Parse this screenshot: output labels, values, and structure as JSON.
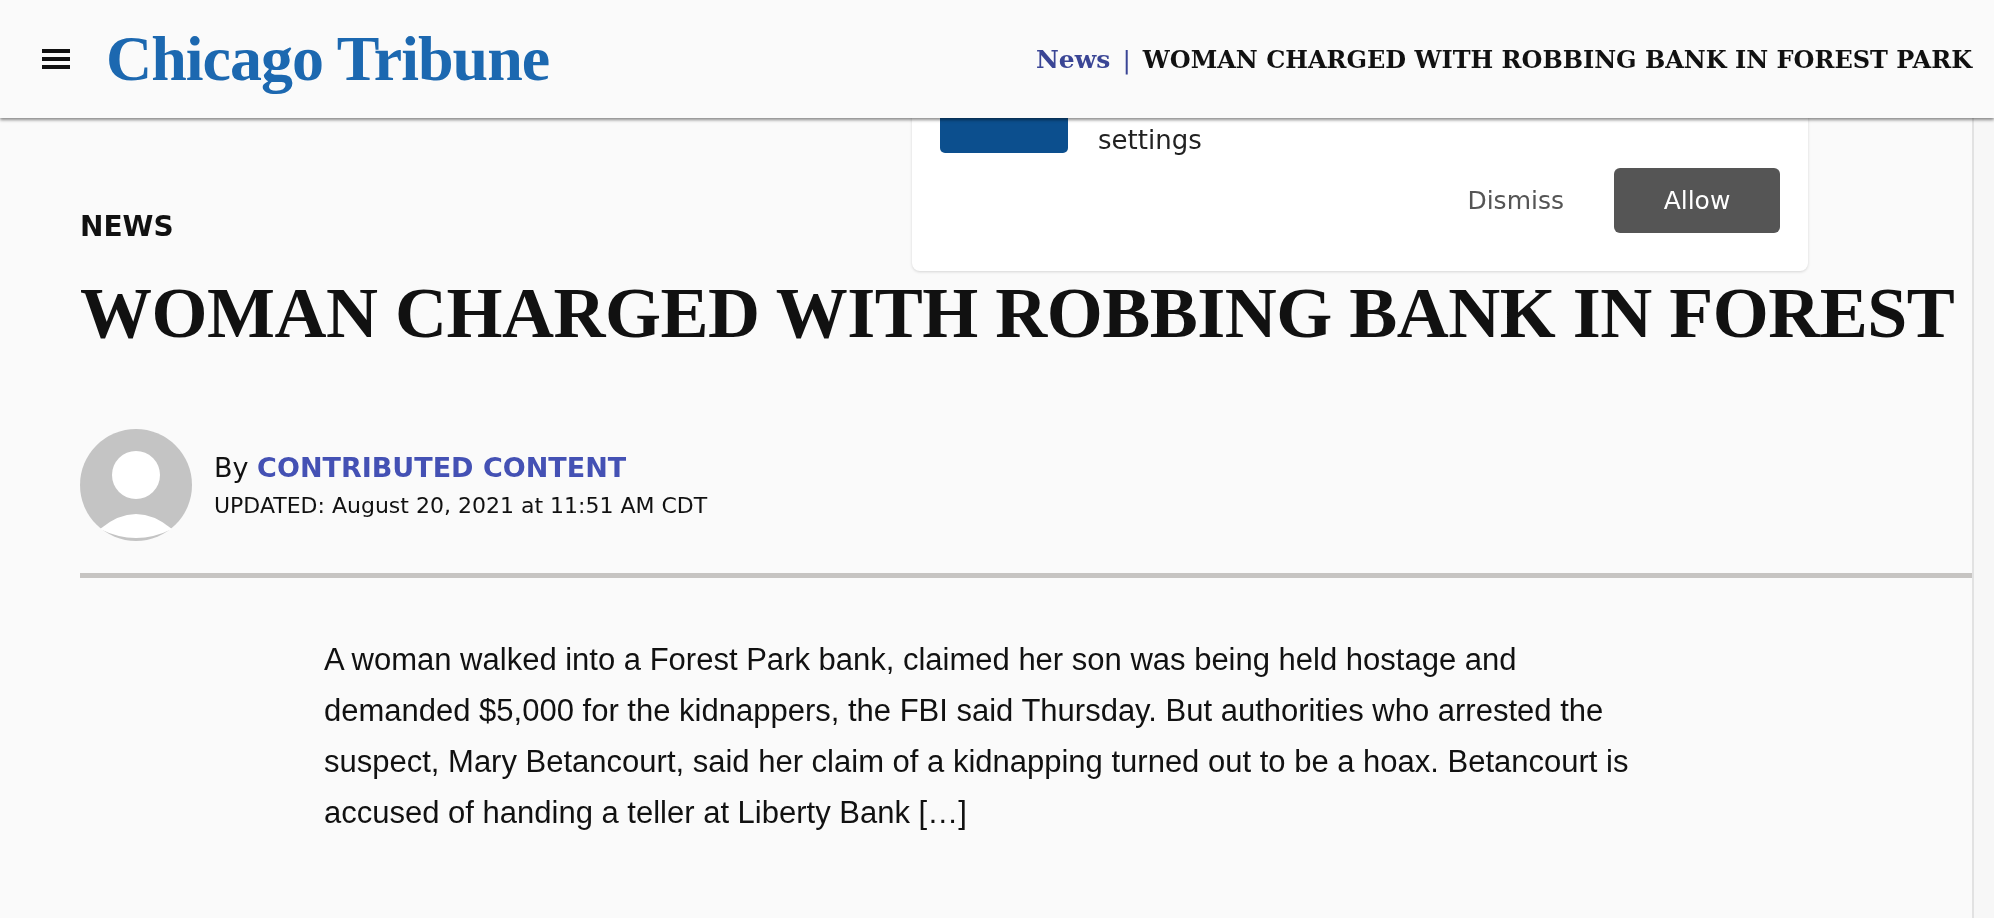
{
  "header": {
    "logo": "Chicago Tribune",
    "section": "News",
    "separator": "|",
    "title": "WOMAN CHARGED WITH ROBBING BANK IN FOREST PARK"
  },
  "notification": {
    "text": "settings",
    "buttons": [
      {
        "label": "Dismiss",
        "kind": "text"
      },
      {
        "label": "Allow",
        "kind": "filled"
      }
    ]
  },
  "article": {
    "section": "NEWS",
    "headline": "WOMAN CHARGED WITH ROBBING BANK IN FOREST",
    "byline_prefix": "By",
    "author": "CONTRIBUTED CONTENT",
    "updated": "UPDATED: August 20, 2021 at 11:51 AM CDT",
    "body": "A woman walked into a Forest Park bank, claimed her son was being held hostage and demanded $5,000 for the kidnappers, the FBI said Thursday. But authorities who arrested the suspect, Mary Betancourt, said her claim of a kidnapping turned out to be a hoax. Betancourt is accused of handing a teller at Liberty Bank […]"
  }
}
